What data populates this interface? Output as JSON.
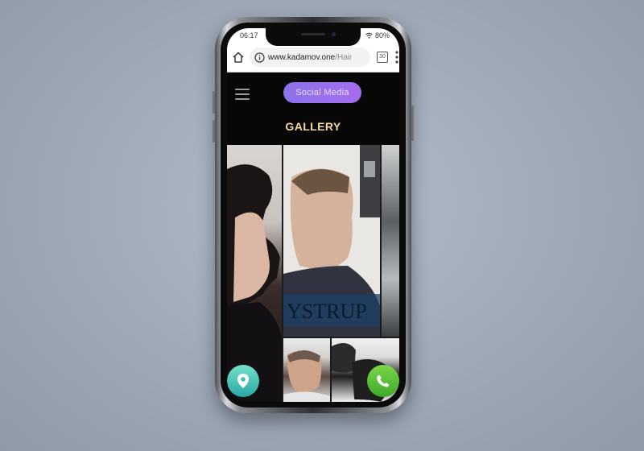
{
  "status_bar": {
    "time": "06:17",
    "battery": "80%"
  },
  "browser": {
    "url_host": "www.kadamov.one",
    "url_path": "/Hair",
    "tabs_count": "30"
  },
  "site": {
    "social_button": "Social Media",
    "gallery_title": "GALLERY"
  },
  "gallery": {
    "overlay_text": "YSTRUP"
  },
  "colors": {
    "accent_purple": "#9b6ff0",
    "title_gold": "#f4d9a6",
    "call_green": "#4cbf34",
    "map_teal": "#3dbfb2"
  }
}
